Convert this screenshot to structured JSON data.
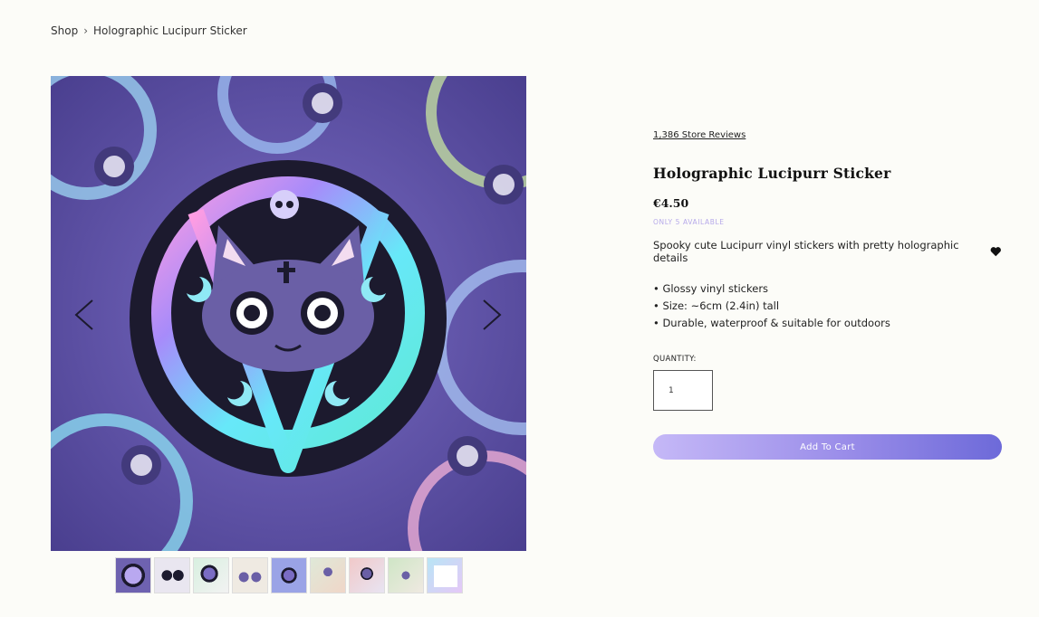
{
  "breadcrumb": {
    "shop": "Shop",
    "separator": "›",
    "current": "Holographic Lucipurr Sticker"
  },
  "gallery": {
    "main_image": "holographic-cat-pentagram-sticker",
    "prev_icon": "chevron-left-icon",
    "next_icon": "chevron-right-icon",
    "thumbnail_count": 9
  },
  "product": {
    "reviews": "1,386 Store Reviews",
    "title": "Holographic Lucipurr Sticker",
    "price": "€4.50",
    "stock": "ONLY 5 AVAILABLE",
    "description": "Spooky cute Lucipurr vinyl stickers with pretty holographic details",
    "bullets": [
      "• Glossy vinyl stickers",
      "• Size: ~6cm (2.4in) tall",
      "• Durable, waterproof & suitable for outdoors"
    ],
    "quantity_label": "QUANTITY:",
    "quantity_value": "1",
    "add_to_cart": "Add To Cart"
  },
  "colors": {
    "background": "#fcfcf8",
    "accent_start": "#c5b8f7",
    "accent_end": "#6d6ad9",
    "stock_text": "#b6a9ea"
  }
}
